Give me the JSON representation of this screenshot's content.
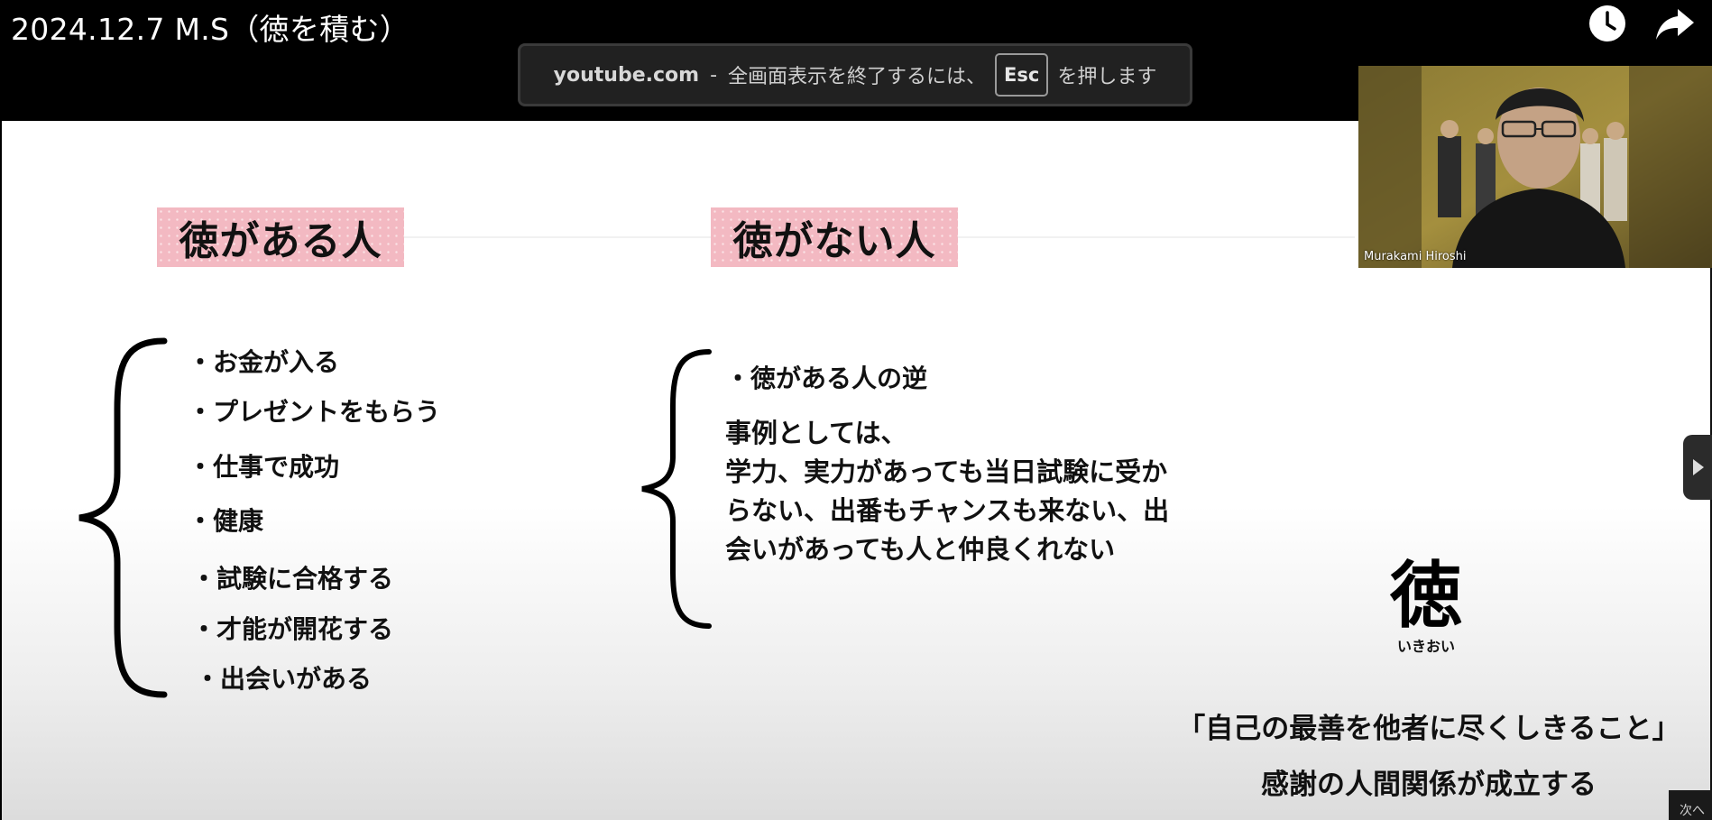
{
  "video": {
    "title": "2024.12.7 M.S（徳を積む）"
  },
  "fullscreen_toast": {
    "domain": "youtube.com",
    "separator": "-",
    "message_before": "全画面表示を終了するには、",
    "key": "Esc",
    "message_after": "を押します"
  },
  "webcam": {
    "participant_name": "Murakami Hiroshi"
  },
  "slide": {
    "left_heading": "徳がある人",
    "right_heading": "徳がない人",
    "left_items": [
      "・お金が入る",
      "・プレゼントをもらう",
      "・仕事で成功",
      "・健康",
      "・試験に合格する",
      "・才能が開花する",
      "・出会いがある"
    ],
    "right_item": "・徳がある人の逆",
    "case_intro": "事例としては、",
    "case_body": "学力、実力があっても当日試験に受からない、出番もチャンスも来ない、出会いがあっても人と仲良くれない",
    "kanji": "徳",
    "kanji_reading": "いきおい",
    "quote": "「自己の最善を他者に尽くしきること」",
    "gratitude": "感謝の人間関係が成立する"
  },
  "controls": {
    "next_label": "次へ"
  },
  "icons": {
    "watch_later": "clock-icon",
    "share": "share-arrow-icon",
    "side_handle": "play-triangle-icon"
  },
  "colors": {
    "tape_pink": "#f3b9c2",
    "toast_bg": "#212121",
    "top_bar": "#000000"
  }
}
